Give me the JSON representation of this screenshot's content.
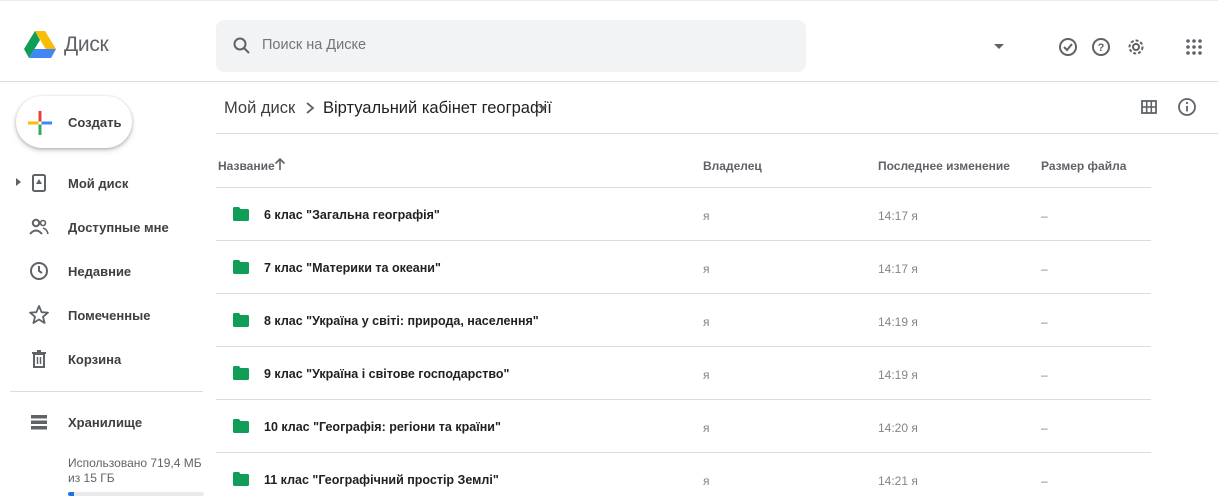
{
  "app": {
    "name": "Диск"
  },
  "search": {
    "placeholder": "Поиск на Диске"
  },
  "sidebar": {
    "create_label": "Создать",
    "items": [
      {
        "label": "Мой диск",
        "icon": "my-drive-icon"
      },
      {
        "label": "Доступные мне",
        "icon": "shared-people-icon"
      },
      {
        "label": "Недавние",
        "icon": "clock-icon"
      },
      {
        "label": "Помеченные",
        "icon": "star-icon"
      },
      {
        "label": "Корзина",
        "icon": "trash-icon"
      }
    ],
    "storage": {
      "label": "Хранилище",
      "usage_text": "Использовано 719,4 МБ из 15 ГБ",
      "used_fraction": 0.047
    }
  },
  "breadcrumb": {
    "root": "Мой диск",
    "current": "Віртуальний кабінет географії"
  },
  "table": {
    "columns": {
      "name": "Название",
      "owner": "Владелец",
      "modified": "Последнее изменение",
      "size": "Размер файла"
    },
    "rows": [
      {
        "name": "6 клас \"Загальна географія\"",
        "owner": "я",
        "modified": "14:17 я",
        "size": "–"
      },
      {
        "name": "7 клас \"Материки та океани\"",
        "owner": "я",
        "modified": "14:17 я",
        "size": "–"
      },
      {
        "name": "8 клас \"Україна у світі: природа, населення\"",
        "owner": "я",
        "modified": "14:19 я",
        "size": "–"
      },
      {
        "name": "9 клас \"Україна і світове господарство\"",
        "owner": "я",
        "modified": "14:19 я",
        "size": "–"
      },
      {
        "name": "10 клас \"Географія: регіони та країни\"",
        "owner": "я",
        "modified": "14:20 я",
        "size": "–"
      },
      {
        "name": "11 клас \"Географічний простір Землі\"",
        "owner": "я",
        "modified": "14:21 я",
        "size": "–"
      }
    ]
  },
  "colors": {
    "folder": "#0f9d58",
    "accent": "#1a73e8",
    "icon_gray": "#5f6368"
  }
}
